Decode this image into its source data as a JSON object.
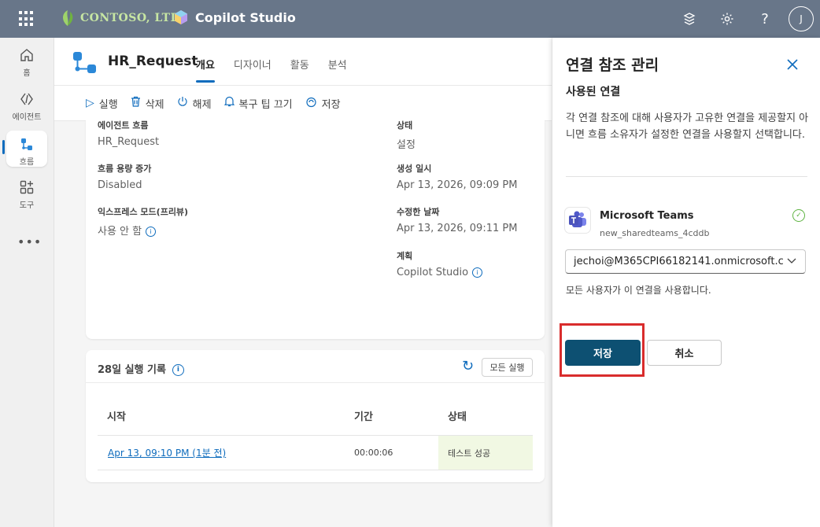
{
  "topbar": {
    "brand": "CONTOSO, LTD.",
    "app_name": "Copilot Studio",
    "avatar_initial": "J",
    "help_label": "?"
  },
  "leftnav": {
    "items": [
      {
        "label": "홈",
        "icon": "home-icon"
      },
      {
        "label": "에이전트",
        "icon": "agent-icon"
      },
      {
        "label": "흐름",
        "icon": "flow-icon"
      },
      {
        "label": "도구",
        "icon": "tools-icon"
      }
    ],
    "more": "•••"
  },
  "header": {
    "title": "HR_Request",
    "tabs": [
      "개요",
      "디자이너",
      "활동",
      "분석"
    ]
  },
  "toolbar": {
    "run": "실행",
    "delete": "삭제",
    "off": "해제",
    "repair_tips_off": "복구 팁 끄기",
    "save": "저장"
  },
  "details": {
    "agent_flow_label": "에이전트 흐름",
    "agent_flow_value": "HR_Request",
    "status_label": "상태",
    "status_value": "설정",
    "capacity_label": "흐름 용량 증가",
    "capacity_value": "Disabled",
    "created_label": "생성 일시",
    "created_value": "Apr 13, 2026, 09:09 PM",
    "express_label": "익스프레스 모드(프리뷰)",
    "express_value": "사용 안 함",
    "modified_label": "수정한 날짜",
    "modified_value": "Apr 13, 2026, 09:11 PM",
    "plan_label": "계획",
    "plan_value": "Copilot Studio"
  },
  "history": {
    "title": "28일 실행 기록",
    "all_runs": "모든 실행",
    "columns": [
      "시작",
      "기간",
      "상태"
    ],
    "rows": [
      {
        "start": "Apr 13, 09:10 PM (1분 전)",
        "duration": "00:00:06",
        "status": "테스트 성공"
      }
    ]
  },
  "panel": {
    "title": "연결 참조 관리",
    "subtitle": "사용된 연결",
    "description": "각 연결 참조에 대해 사용자가 고유한 연결을 제공할지 아니면 흐름 소유자가 설정한 연결을 사용할지 선택합니다.",
    "connection_name": "Microsoft Teams",
    "connection_id": "new_sharedteams_4cddb",
    "selected_account": "jechoi@M365CPI66182141.onmicrosoft.co",
    "note": "모든 사용자가 이 연결을 사용합니다.",
    "save": "저장",
    "cancel": "취소"
  },
  "colors": {
    "topbar": "#687689",
    "accent": "#0f6cbd",
    "save_button": "#0d5072",
    "success_bg": "#f1f8e3",
    "highlight": "#d92c2c"
  }
}
